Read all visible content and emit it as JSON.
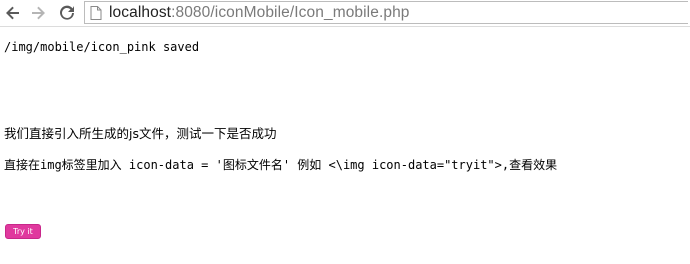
{
  "browser": {
    "url_host": "localhost",
    "url_rest": ":8080/iconMobile/Icon_mobile.php"
  },
  "page": {
    "saved_message": "/img/mobile/icon_pink saved",
    "intro_text": "我们直接引入所生成的js文件，测试一下是否成功",
    "usage_text": "直接在img标签里加入 icon-data = '图标文件名' 例如 <\\img icon-data=\"tryit\">,查看效果",
    "try_button_label": "Try it"
  },
  "colors": {
    "try_button_bg": "#e0399e"
  },
  "icons": {
    "back": "arrow-left-icon",
    "forward": "arrow-right-icon",
    "reload": "reload-icon",
    "page": "page-icon"
  }
}
